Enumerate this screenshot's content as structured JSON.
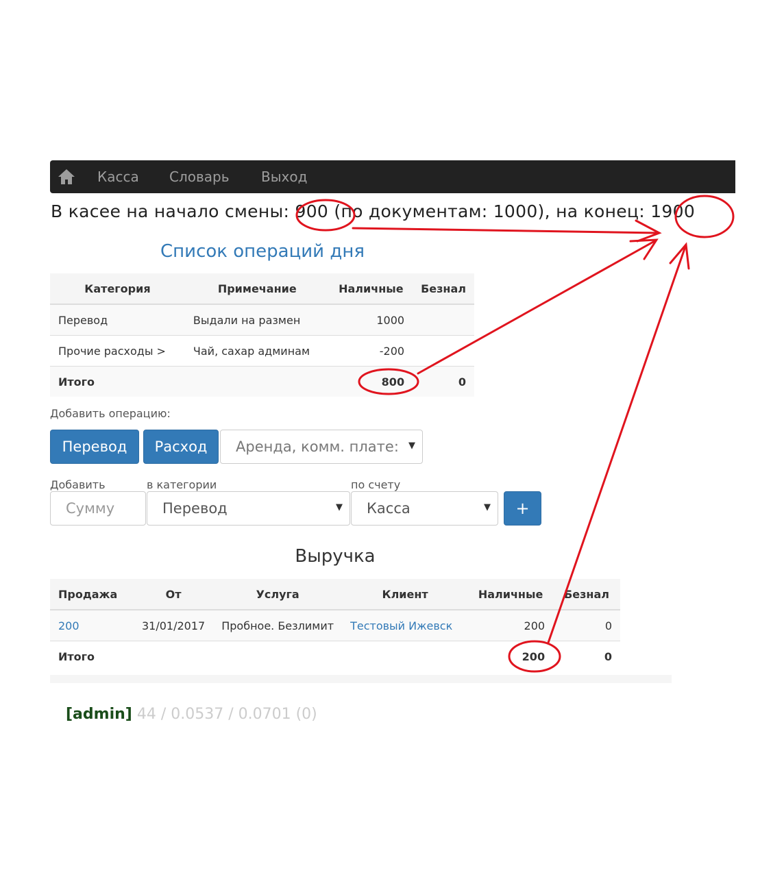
{
  "nav": {
    "items": [
      "Касса",
      "Словарь",
      "Выход"
    ]
  },
  "summary": {
    "prefix": "В касее на начало смены:",
    "start": "900",
    "docs": "(по документам: 1000), на конец:",
    "end": "1900"
  },
  "ops": {
    "title": "Список операций дня",
    "headers": [
      "Категория",
      "Примечание",
      "Наличные",
      "Безнал"
    ],
    "rows": [
      [
        "Перевод",
        "Выдали на размен",
        "1000",
        ""
      ],
      [
        "Прочие расходы >",
        "Чай, сахар админам",
        "-200",
        ""
      ]
    ],
    "total": [
      "Итого",
      "",
      "800",
      "0"
    ]
  },
  "add_op": {
    "label": "Добавить операцию:",
    "btn_transfer": "Перевод",
    "btn_expense": "Расход",
    "expense_select": "Аренда, комм. плате:",
    "lbl_add": "Добавить",
    "lbl_cat": "в категории",
    "lbl_acc": "по счету",
    "sum_placeholder": "Сумму",
    "cat_value": "Перевод",
    "acc_value": "Касса",
    "plus": "+"
  },
  "revenue": {
    "title": "Выручка",
    "headers": [
      "Продажа",
      "От",
      "Услуга",
      "Клиент",
      "Наличные",
      "Безнал"
    ],
    "rows": [
      [
        "200",
        "31/01/2017",
        "Пробное. Безлимит",
        "Тестовый Ижевск",
        "200",
        "0"
      ]
    ],
    "total": [
      "Итого",
      "",
      "",
      "",
      "200",
      "0"
    ]
  },
  "footer": {
    "user": "[admin]",
    "stats": "44 / 0.0537 / 0.0701 (0)"
  },
  "colors": {
    "annotation": "#e0141e",
    "link": "#337ab7",
    "navbar": "#222222"
  }
}
